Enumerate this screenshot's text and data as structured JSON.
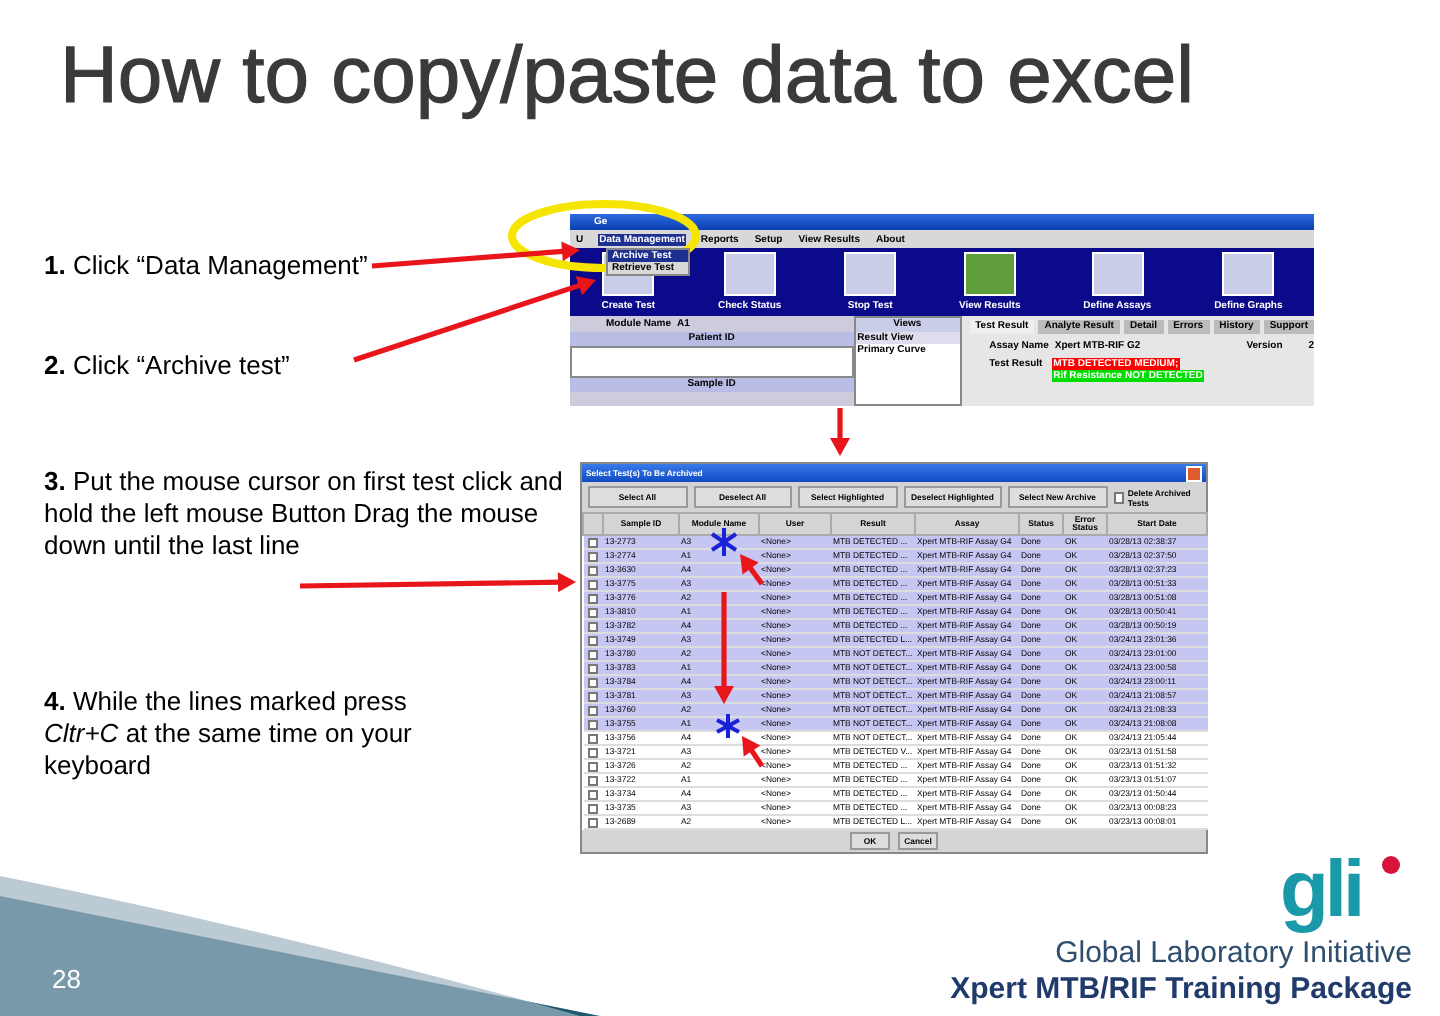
{
  "slide": {
    "title": "How to copy/paste data to excel",
    "page_number": "28"
  },
  "steps": [
    "**1.** Click “Data Management”",
    "**2.** Click “Archive test”",
    "**3.** Put the mouse cursor on first test click and hold the left mouse Button Drag the mouse down until the last line",
    "**4.** While the lines marked press *Cltr+C* at the same time on your keyboard"
  ],
  "app_window": {
    "title": "Ge",
    "menu": [
      {
        "label": "U",
        "selected": false
      },
      {
        "label": "Data Management",
        "selected": true
      },
      {
        "label": "Reports",
        "selected": false
      },
      {
        "label": "Setup",
        "selected": false
      },
      {
        "label": "View Results",
        "selected": false
      },
      {
        "label": "About",
        "selected": false
      }
    ],
    "dropdown": [
      {
        "label": "Archive Test",
        "selected": true
      },
      {
        "label": "Retrieve Test",
        "selected": false
      }
    ],
    "toolbar": [
      {
        "label": "Create Test",
        "selected": false
      },
      {
        "label": "Check Status",
        "selected": false
      },
      {
        "label": "Stop Test",
        "selected": false
      },
      {
        "label": "View Results",
        "selected": true
      },
      {
        "label": "Define Assays",
        "selected": false
      },
      {
        "label": "Define Graphs",
        "selected": false
      }
    ],
    "module_label": "Module Name",
    "module_value": "A1",
    "patient_label": "Patient ID",
    "sample_label": "Sample ID",
    "views_header": "Views",
    "views": [
      {
        "label": "Result View",
        "selected": true
      },
      {
        "label": "Primary Curve",
        "selected": false
      }
    ],
    "tabs": [
      {
        "label": "Test Result",
        "selected": true
      },
      {
        "label": "Analyte Result",
        "selected": false
      },
      {
        "label": "Detail",
        "selected": false
      },
      {
        "label": "Errors",
        "selected": false
      },
      {
        "label": "History",
        "selected": false
      },
      {
        "label": "Support",
        "selected": false
      }
    ],
    "assay_label": "Assay Name",
    "assay_value": "Xpert MTB-RIF G2",
    "version_label": "Version",
    "version_value": "2",
    "result_label": "Test Result",
    "results": [
      {
        "text": "MTB DETECTED MEDIUM;",
        "color": "#ff0000"
      },
      {
        "text": "Rif Resistance NOT DETECTED",
        "color": "#00dd00"
      }
    ]
  },
  "dialog": {
    "title": "Select Test(s) To Be Archived",
    "buttons": [
      "Select All",
      "Deselect All",
      "Select Highlighted",
      "Deselect Highlighted",
      "Select New Archive"
    ],
    "delete_option": {
      "label": "Delete Archived Tests",
      "checked": false
    },
    "columns": [
      "Sample ID",
      "Module Name",
      "User",
      "Result",
      "Assay",
      "Status",
      "Error Status",
      "Start Date"
    ],
    "rows": [
      {
        "selected": true,
        "checked": false,
        "cells": [
          "13-2773",
          "A3",
          "<None>",
          "MTB DETECTED ...",
          "Xpert MTB-RIF Assay G4",
          "Done",
          "OK",
          "03/28/13 02:38:37"
        ]
      },
      {
        "selected": true,
        "checked": false,
        "cells": [
          "13-2774",
          "A1",
          "<None>",
          "MTB DETECTED ...",
          "Xpert MTB-RIF Assay G4",
          "Done",
          "OK",
          "03/28/13 02:37:50"
        ]
      },
      {
        "selected": true,
        "checked": false,
        "cells": [
          "13-3630",
          "A4",
          "<None>",
          "MTB DETECTED ...",
          "Xpert MTB-RIF Assay G4",
          "Done",
          "OK",
          "03/28/13 02:37:23"
        ]
      },
      {
        "selected": true,
        "checked": false,
        "cells": [
          "13-3775",
          "A3",
          "<None>",
          "MTB DETECTED ...",
          "Xpert MTB-RIF Assay G4",
          "Done",
          "OK",
          "03/28/13 00:51:33"
        ]
      },
      {
        "selected": true,
        "checked": false,
        "cells": [
          "13-3776",
          "A2",
          "<None>",
          "MTB DETECTED ...",
          "Xpert MTB-RIF Assay G4",
          "Done",
          "OK",
          "03/28/13 00:51:08"
        ]
      },
      {
        "selected": true,
        "checked": false,
        "cells": [
          "13-3810",
          "A1",
          "<None>",
          "MTB DETECTED ...",
          "Xpert MTB-RIF Assay G4",
          "Done",
          "OK",
          "03/28/13 00:50:41"
        ]
      },
      {
        "selected": true,
        "checked": false,
        "cells": [
          "13-3782",
          "A4",
          "<None>",
          "MTB DETECTED ...",
          "Xpert MTB-RIF Assay G4",
          "Done",
          "OK",
          "03/28/13 00:50:19"
        ]
      },
      {
        "selected": true,
        "checked": false,
        "cells": [
          "13-3749",
          "A3",
          "<None>",
          "MTB DETECTED L...",
          "Xpert MTB-RIF Assay G4",
          "Done",
          "OK",
          "03/24/13 23:01:36"
        ]
      },
      {
        "selected": true,
        "checked": false,
        "cells": [
          "13-3780",
          "A2",
          "<None>",
          "MTB NOT DETECT...",
          "Xpert MTB-RIF Assay G4",
          "Done",
          "OK",
          "03/24/13 23:01:00"
        ]
      },
      {
        "selected": true,
        "checked": false,
        "cells": [
          "13-3783",
          "A1",
          "<None>",
          "MTB NOT DETECT...",
          "Xpert MTB-RIF Assay G4",
          "Done",
          "OK",
          "03/24/13 23:00:58"
        ]
      },
      {
        "selected": true,
        "checked": false,
        "cells": [
          "13-3784",
          "A4",
          "<None>",
          "MTB NOT DETECT...",
          "Xpert MTB-RIF Assay G4",
          "Done",
          "OK",
          "03/24/13 23:00:11"
        ]
      },
      {
        "selected": true,
        "checked": false,
        "cells": [
          "13-3781",
          "A3",
          "<None>",
          "MTB NOT DETECT...",
          "Xpert MTB-RIF Assay G4",
          "Done",
          "OK",
          "03/24/13 21:08:57"
        ]
      },
      {
        "selected": true,
        "checked": false,
        "cells": [
          "13-3760",
          "A2",
          "<None>",
          "MTB NOT DETECT...",
          "Xpert MTB-RIF Assay G4",
          "Done",
          "OK",
          "03/24/13 21:08:33"
        ]
      },
      {
        "selected": true,
        "checked": false,
        "cells": [
          "13-3755",
          "A1",
          "<None>",
          "MTB NOT DETECT...",
          "Xpert MTB-RIF Assay G4",
          "Done",
          "OK",
          "03/24/13 21:08:08"
        ]
      },
      {
        "selected": false,
        "checked": false,
        "cells": [
          "13-3756",
          "A4",
          "<None>",
          "MTB NOT DETECT...",
          "Xpert MTB-RIF Assay G4",
          "Done",
          "OK",
          "03/24/13 21:05:44"
        ]
      },
      {
        "selected": false,
        "checked": false,
        "cells": [
          "13-3721",
          "A3",
          "<None>",
          "MTB DETECTED V...",
          "Xpert MTB-RIF Assay G4",
          "Done",
          "OK",
          "03/23/13 01:51:58"
        ]
      },
      {
        "selected": false,
        "checked": false,
        "cells": [
          "13-3726",
          "A2",
          "<None>",
          "MTB DETECTED ...",
          "Xpert MTB-RIF Assay G4",
          "Done",
          "OK",
          "03/23/13 01:51:32"
        ]
      },
      {
        "selected": false,
        "checked": false,
        "cells": [
          "13-3722",
          "A1",
          "<None>",
          "MTB DETECTED ...",
          "Xpert MTB-RIF Assay G4",
          "Done",
          "OK",
          "03/23/13 01:51:07"
        ]
      },
      {
        "selected": false,
        "checked": false,
        "cells": [
          "13-3734",
          "A4",
          "<None>",
          "MTB DETECTED ...",
          "Xpert MTB-RIF Assay G4",
          "Done",
          "OK",
          "03/23/13 01:50:44"
        ]
      },
      {
        "selected": false,
        "checked": false,
        "cells": [
          "13-3735",
          "A3",
          "<None>",
          "MTB DETECTED ...",
          "Xpert MTB-RIF Assay G4",
          "Done",
          "OK",
          "03/23/13 00:08:23"
        ]
      },
      {
        "selected": false,
        "checked": false,
        "cells": [
          "13-2689",
          "A2",
          "<None>",
          "MTB DETECTED L...",
          "Xpert MTB-RIF Assay G4",
          "Done",
          "OK",
          "03/23/13 00:08:01"
        ]
      }
    ],
    "ok": "OK",
    "cancel": "Cancel"
  },
  "footer": {
    "logo": "gli",
    "organization": "Global Laboratory Initiative",
    "package": "Xpert MTB/RIF Training Package"
  }
}
